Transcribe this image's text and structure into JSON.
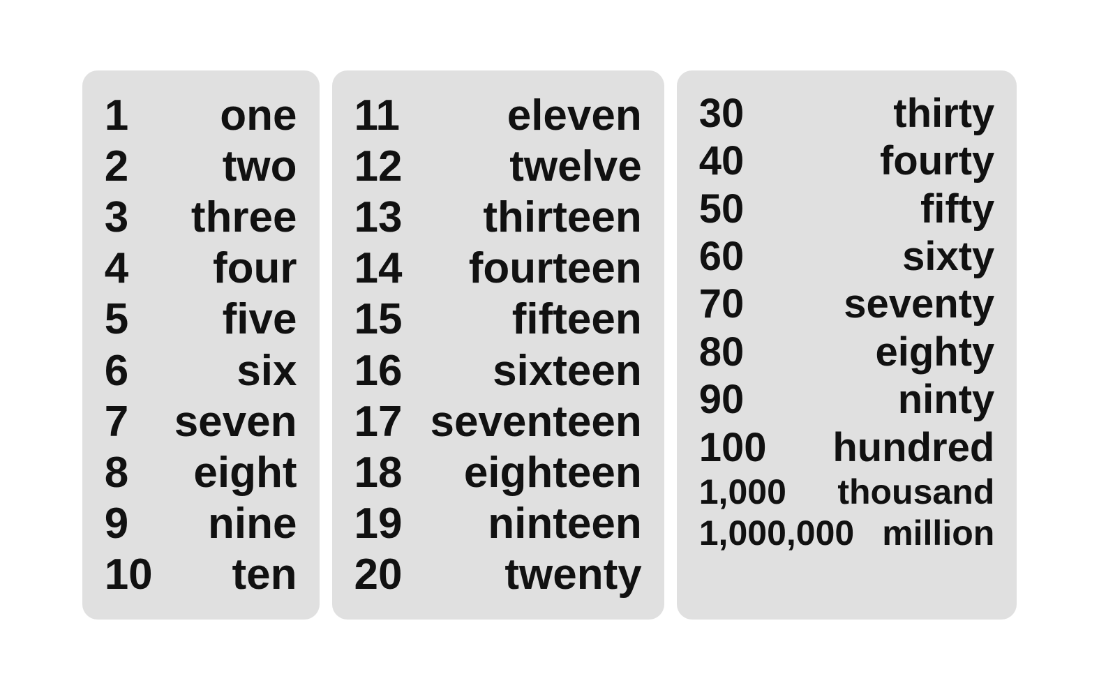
{
  "card1": {
    "rows": [
      {
        "num": "1",
        "word": "one"
      },
      {
        "num": "2",
        "word": "two"
      },
      {
        "num": "3",
        "word": "three"
      },
      {
        "num": "4",
        "word": "four"
      },
      {
        "num": "5",
        "word": "five"
      },
      {
        "num": "6",
        "word": "six"
      },
      {
        "num": "7",
        "word": "seven"
      },
      {
        "num": "8",
        "word": "eight"
      },
      {
        "num": "9",
        "word": "nine"
      },
      {
        "num": "10",
        "word": "ten"
      }
    ]
  },
  "card2": {
    "rows": [
      {
        "num": "11",
        "word": "eleven"
      },
      {
        "num": "12",
        "word": "twelve"
      },
      {
        "num": "13",
        "word": "thirteen"
      },
      {
        "num": "14",
        "word": "fourteen"
      },
      {
        "num": "15",
        "word": "fifteen"
      },
      {
        "num": "16",
        "word": "sixteen"
      },
      {
        "num": "17",
        "word": "seventeen"
      },
      {
        "num": "18",
        "word": "eighteen"
      },
      {
        "num": "19",
        "word": "ninteen"
      },
      {
        "num": "20",
        "word": "twenty"
      }
    ]
  },
  "card3": {
    "rows": [
      {
        "num": "30",
        "word": "thirty",
        "class": ""
      },
      {
        "num": "40",
        "word": "fourty",
        "class": ""
      },
      {
        "num": "50",
        "word": "fifty",
        "class": ""
      },
      {
        "num": "60",
        "word": "sixty",
        "class": ""
      },
      {
        "num": "70",
        "word": "seventy",
        "class": ""
      },
      {
        "num": "80",
        "word": "eighty",
        "class": ""
      },
      {
        "num": "90",
        "word": "ninty",
        "class": ""
      },
      {
        "num": "100",
        "word": "hundred",
        "class": ""
      },
      {
        "num": "1,000",
        "word": "thousand",
        "class": "row-thousand"
      },
      {
        "num": "1,000,000",
        "word": "million",
        "class": "row-million"
      }
    ]
  }
}
